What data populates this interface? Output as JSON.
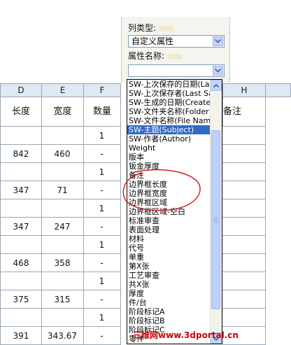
{
  "spreadsheet": {
    "columns": [
      {
        "letter": "D",
        "header": "长度"
      },
      {
        "letter": "E",
        "header": "宽度"
      },
      {
        "letter": "F",
        "header": "数量"
      },
      {
        "letter": "H",
        "header": "备注"
      }
    ],
    "rows": [
      {
        "d": "",
        "e": "",
        "f": "1"
      },
      {
        "d": "842",
        "e": "460",
        "f": "-"
      },
      {
        "d": "",
        "e": "",
        "f": "1"
      },
      {
        "d": "347",
        "e": "71",
        "f": "-"
      },
      {
        "d": "",
        "e": "",
        "f": "1"
      },
      {
        "d": "347",
        "e": "247",
        "f": "-"
      },
      {
        "d": "",
        "e": "",
        "f": "1"
      },
      {
        "d": "468",
        "e": "358",
        "f": "-"
      },
      {
        "d": "",
        "e": "",
        "f": "1"
      },
      {
        "d": "375",
        "e": "315",
        "f": "-"
      },
      {
        "d": "",
        "e": "",
        "f": "1"
      },
      {
        "d": "391",
        "e": "343.67",
        "f": "-"
      }
    ]
  },
  "panel": {
    "column_type_label": "列类型:",
    "column_type_value": "自定义属性",
    "property_name_label": "属性名称:",
    "property_name_value": ""
  },
  "dropdown": {
    "selected_index": 5,
    "items": [
      "SW-上次保存的日期(La",
      "SW-上次保存者(Last Sa",
      "SW-生成的日期(Create",
      "SW-文件夹名称(Folder",
      "SW-文件名称(File Name",
      "SW-主题(Subject)",
      "SW-作者(Author)",
      "Weight",
      "版本",
      "钣金厚度",
      "备注",
      "边界框长度",
      "边界框宽度",
      "边界框区域",
      "边界框区域-空白",
      "标准审查",
      "表面处理",
      "材料",
      "代号",
      "单重",
      "第X张",
      "工艺审查",
      "共X张",
      "厚度",
      "件/台",
      "阶段标记A",
      "阶段标记B",
      "阶段标记C",
      "零件"
    ]
  },
  "watermark": "三维网www.3dportal.cn",
  "colors": {
    "selection": "#316ac5",
    "annotation": "#d0201f"
  }
}
